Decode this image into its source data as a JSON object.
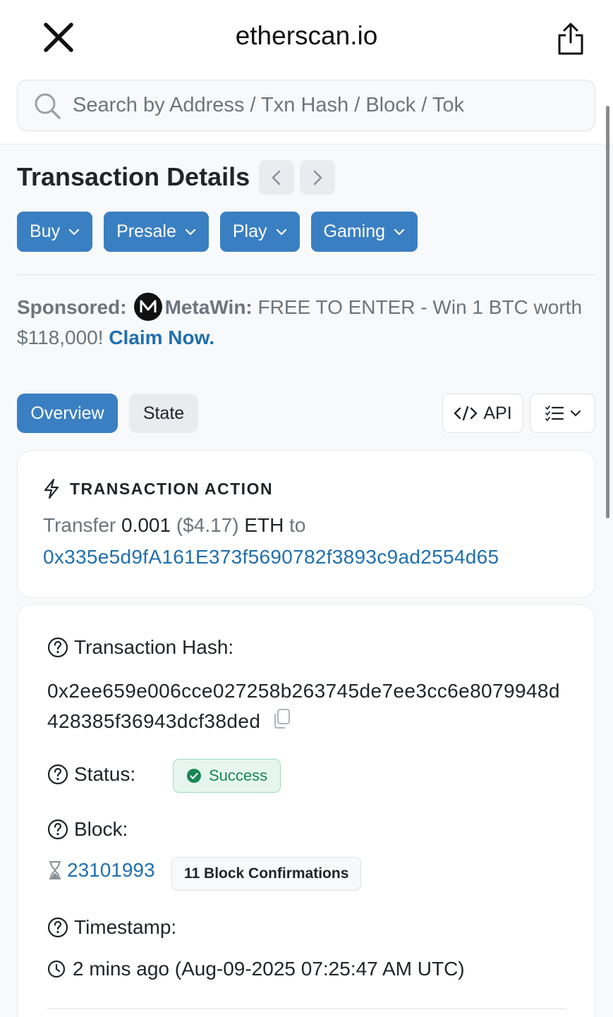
{
  "browser": {
    "domain": "etherscan.io",
    "search_placeholder": "Search by Address / Txn Hash / Block / Tok"
  },
  "page": {
    "title": "Transaction Details",
    "categories": [
      "Buy",
      "Presale",
      "Play",
      "Gaming"
    ]
  },
  "sponsor": {
    "label": "Sponsored:",
    "brand": "MetaWin:",
    "text": " FREE TO ENTER - Win 1 BTC worth $118,000! ",
    "cta": "Claim Now."
  },
  "tabs": {
    "overview": "Overview",
    "state": "State",
    "api": "API"
  },
  "action": {
    "heading": "TRANSACTION ACTION",
    "prefix": "Transfer ",
    "amount": "0.001",
    "usd": " ($4.17) ",
    "token": "ETH",
    "to": " to",
    "address": "0x335e5d9fA161E373f5690782f3893c9ad2554d65"
  },
  "details": {
    "hash_label": "Transaction Hash:",
    "hash_value": "0x2ee659e006cce027258b263745de7ee3cc6e8079948d428385f36943dcf38ded",
    "status_label": "Status:",
    "status_value": "Success",
    "block_label": "Block:",
    "block_value": "23101993",
    "confirmations": "11 Block Confirmations",
    "timestamp_label": "Timestamp:",
    "timestamp_value": "2 mins ago (Aug-09-2025 07:25:47 AM UTC)"
  },
  "colors": {
    "primary": "#3a7fc2",
    "link": "#1f6fae",
    "success": "#198754"
  }
}
